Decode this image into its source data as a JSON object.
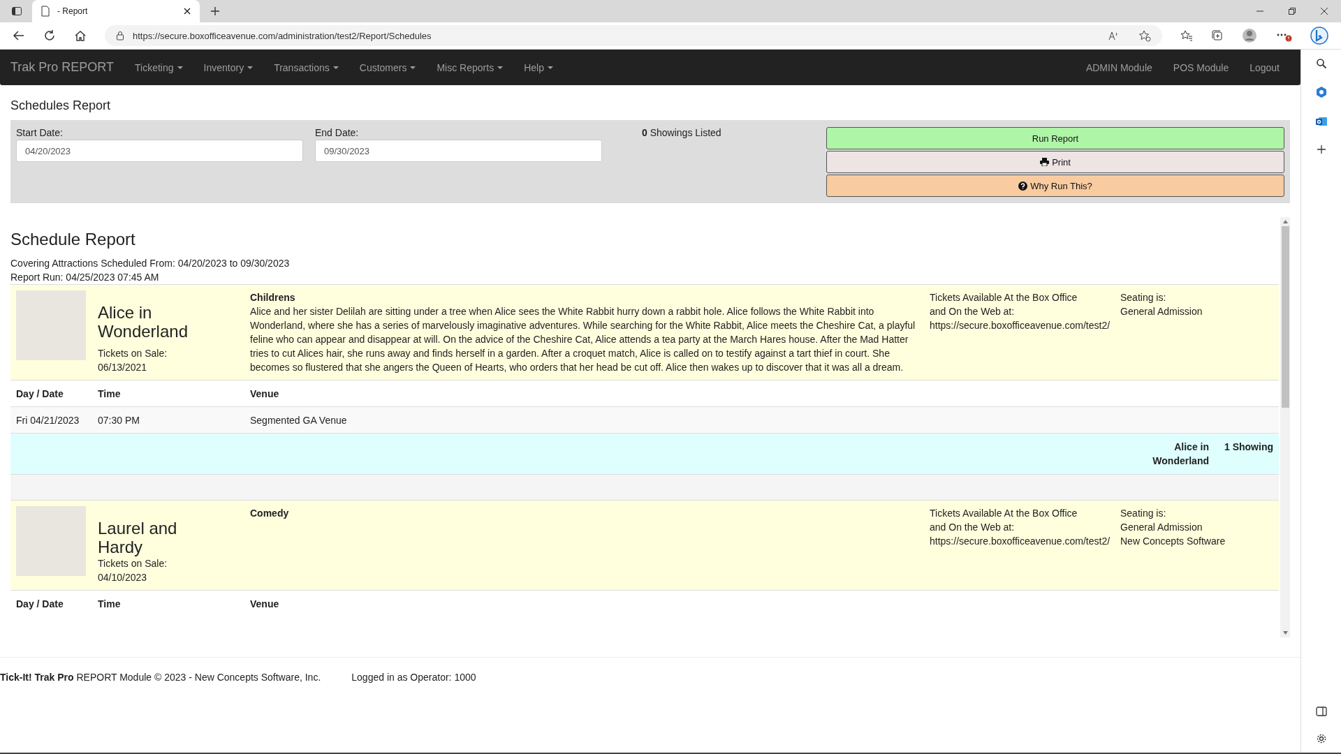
{
  "browser": {
    "tab_title": "- Report",
    "url": "https://secure.boxofficeavenue.com/administration/test2/Report/Schedules"
  },
  "navbar": {
    "brand": "Trak Pro REPORT",
    "menus": [
      {
        "label": "Ticketing",
        "dropdown": true
      },
      {
        "label": "Inventory",
        "dropdown": true
      },
      {
        "label": "Transactions",
        "dropdown": true
      },
      {
        "label": "Customers",
        "dropdown": true
      },
      {
        "label": "Misc Reports",
        "dropdown": true
      },
      {
        "label": "Help",
        "dropdown": true
      }
    ],
    "right_links": [
      "ADMIN Module",
      "POS Module",
      "Logout"
    ]
  },
  "page_title": "Schedules Report",
  "filters": {
    "start_date": {
      "label": "Start Date:",
      "value": "04/20/2023"
    },
    "end_date": {
      "label": "End Date:",
      "value": "09/30/2023"
    },
    "showings": "**0** Showings Listed",
    "buttons": [
      {
        "label": "Run Report",
        "kind": "run"
      },
      {
        "label": "Print",
        "kind": "print"
      },
      {
        "label": "Why Run This?",
        "kind": "help"
      }
    ]
  },
  "report": {
    "title": "Schedule Report",
    "covering": "Covering Attractions Scheduled From: 04/20/2023 to 09/30/2023",
    "run": "Report Run: 04/25/2023 07:45 AM"
  },
  "attractions": [
    {
      "name": "Alice in Wonderland",
      "sale_label": "Tickets on Sale:",
      "sale_date": "06/13/2021",
      "category": "Childrens",
      "description": "Alice and her sister Delilah are sitting under a tree when Alice sees the White Rabbit hurry down a rabbit hole. Alice follows the White Rabbit into Wonderland, where she has a series of marvelously imaginative adventures. While searching for the White Rabbit, Alice meets the Cheshire Cat, a playful feline who can appear and disappear at will. On the advice of the Cheshire Cat, Alice attends a tea party at the March Hares house. After the Mad Hatter tries to cut Alices hair, she runs away and finds herself in a garden. After a croquet match, Alice is called on to testify against a tart thief in court. She becomes so flustered that she angers the Queen of Hearts, who orders that her head be cut off. Alice then wakes up to discover that it was all a dream.",
      "availability": [
        "Tickets Available At the Box Office",
        "and On the Web at:",
        "https://secure.boxofficeavenue.com/test2/"
      ],
      "seating": [
        "Seating is:",
        "General Admission"
      ],
      "columns": [
        "Day / Date",
        "Time",
        "Venue"
      ],
      "rows": [
        {
          "day_date": "Fri 04/21/2023",
          "time": "07:30 PM",
          "venue": "Segmented GA Venue"
        }
      ],
      "summary": {
        "name": "Alice in Wonderland",
        "count": "1 Showing"
      }
    },
    {
      "name": "Laurel and Hardy",
      "sale_label": "Tickets on Sale:",
      "sale_date": "04/10/2023",
      "category": "Comedy",
      "availability": [
        "Tickets Available At the Box Office",
        "and On the Web at:",
        "https://secure.boxofficeavenue.com/test2/"
      ],
      "seating": [
        "Seating is:",
        "General Admission",
        "New Concepts Software"
      ],
      "columns": [
        "Day / Date",
        "Time",
        "Venue"
      ]
    }
  ],
  "footer": {
    "copyright": "**Tick-It! Trak Pro** REPORT Module © 2023 - New Concepts Software, Inc.",
    "operator": "Logged in as Operator: 1000"
  }
}
